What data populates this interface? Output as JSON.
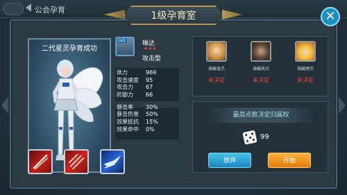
{
  "breadcrumb": "公会孕育",
  "dialog": {
    "title": "1级孕育室"
  },
  "hero": {
    "caption": "二代星灵孕育成功",
    "level": "Lv1",
    "name": "琳达",
    "stars": "★★★",
    "type": "攻击型",
    "stats_primary": [
      {
        "label": "体力",
        "value": "969"
      },
      {
        "label": "攻击速度",
        "value": "95"
      },
      {
        "label": "攻击力",
        "value": "67"
      },
      {
        "label": "防御力",
        "value": "66"
      }
    ],
    "stats_secondary": [
      {
        "label": "暴击率",
        "value": "30%"
      },
      {
        "label": "暴击伤害",
        "value": "50%"
      },
      {
        "label": "效果抵抗",
        "value": "15%"
      },
      {
        "label": "效果命中",
        "value": "0%"
      }
    ],
    "skill_icons": [
      "slash-skill-icon",
      "claw-skill-icon",
      "dash-skill-icon"
    ]
  },
  "pets": [
    {
      "name": "海椒龙爪",
      "status": "未决定",
      "icon": "lion-pet-icon"
    },
    {
      "name": "海椒凤爪",
      "status": "未决定",
      "icon": "monkey-pet-icon"
    },
    {
      "name": "海椒虎爪",
      "status": "未决定",
      "icon": "blonde-pet-icon"
    }
  ],
  "priority": {
    "label": "最高点数决定归属权",
    "dice_value": "99"
  },
  "buttons": {
    "give_up": "放弃",
    "start": "开始"
  },
  "colors": {
    "undecided": "#f0463e",
    "giveup_button": "#1d86c2",
    "start_button": "#e27c0c",
    "close_button": "#1c8fbf"
  }
}
